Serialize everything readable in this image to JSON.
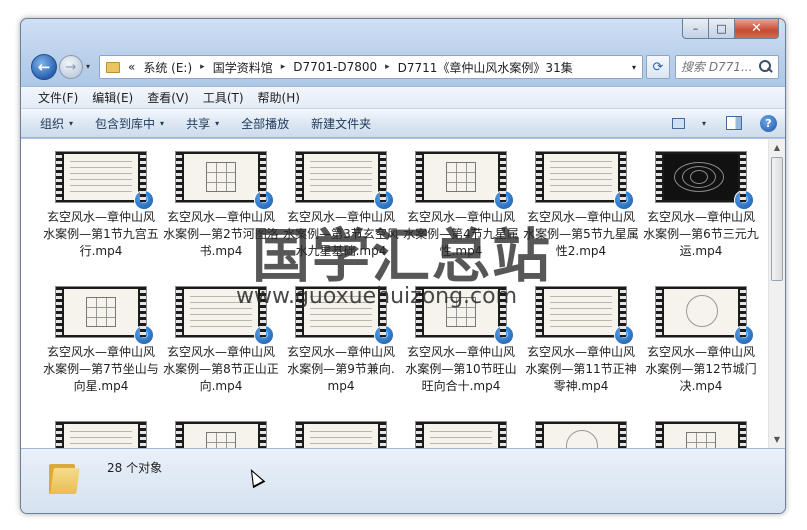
{
  "window": {
    "caption": {
      "minimize": "–",
      "maximize": "□",
      "close": "✕"
    }
  },
  "address": {
    "prefix": "«",
    "crumbs": [
      "系统 (E:)",
      "国学资料馆",
      "D7701-D7800",
      "D7711《章仲山风水案例》31集"
    ],
    "separator": "▸",
    "dropdown": "▾",
    "refresh": "⟳"
  },
  "search": {
    "placeholder": "搜索 D771..."
  },
  "menu": [
    "文件(F)",
    "编辑(E)",
    "查看(V)",
    "工具(T)",
    "帮助(H)"
  ],
  "toolbar": {
    "organize": "组织",
    "include_library": "包含到库中",
    "share": "共享",
    "play_all": "全部播放",
    "new_folder": "新建文件夹",
    "caret": "▾",
    "help": "?"
  },
  "files": [
    {
      "name": "玄空风水—章仲山风水案例—第1节九宫五行.mp4",
      "thumb": "doc"
    },
    {
      "name": "玄空风水—章仲山风水案例—第2节河图洛书.mp4",
      "thumb": "diagram"
    },
    {
      "name": "玄空风水—章仲山风水案例—第3节玄空风水九星基础.mp4",
      "thumb": "hand"
    },
    {
      "name": "玄空风水—章仲山风水案例—第4节九星属性.mp4",
      "thumb": "grid"
    },
    {
      "name": "玄空风水—章仲山风水案例—第5节九星属性2.mp4",
      "thumb": "text"
    },
    {
      "name": "玄空风水—章仲山风水案例—第6节三元九运.mp4",
      "thumb": "space"
    },
    {
      "name": "玄空风水—章仲山风水案例—第7节坐山与向星.mp4",
      "thumb": "grid"
    },
    {
      "name": "玄空风水—章仲山风水案例—第8节正山正向.mp4",
      "thumb": "text"
    },
    {
      "name": "玄空风水—章仲山风水案例—第9节兼向.mp4",
      "thumb": "text"
    },
    {
      "name": "玄空风水—章仲山风水案例—第10节旺山旺向合十.mp4",
      "thumb": "grid"
    },
    {
      "name": "玄空风水—章仲山风水案例—第11节正神零神.mp4",
      "thumb": "doc"
    },
    {
      "name": "玄空风水—章仲山风水案例—第12节城门决.mp4",
      "thumb": "yinyang"
    },
    {
      "name": "",
      "thumb": "text"
    },
    {
      "name": "",
      "thumb": "grid"
    },
    {
      "name": "",
      "thumb": "text"
    },
    {
      "name": "",
      "thumb": "text"
    },
    {
      "name": "",
      "thumb": "compass"
    },
    {
      "name": "",
      "thumb": "grid"
    }
  ],
  "watermark": {
    "title": "国学汇总站",
    "url": "www.guoxuehuizong.com"
  },
  "details": {
    "count": "28 个对象"
  },
  "scrollbar": {
    "up": "▲",
    "down": "▼"
  },
  "icons": {
    "back": "back-arrow-icon",
    "forward": "forward-arrow-icon",
    "search": "search-icon",
    "media": "media-player-icon"
  }
}
